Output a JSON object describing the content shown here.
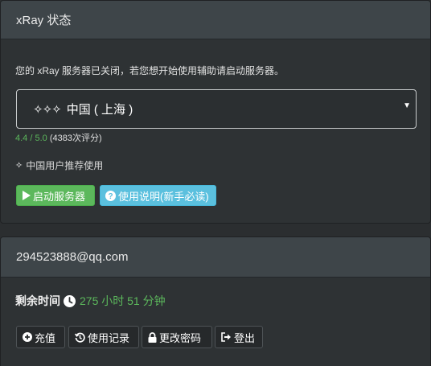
{
  "status_panel": {
    "title": "xRay 状态",
    "description": "您的 xRay 服务器已关闭，若您想开始使用辅助请启动服务器。",
    "server_select": {
      "selected": "中国 ( 上海 )",
      "rating_score": "4.4 / 5.0",
      "rating_count": "(4383次评分)"
    },
    "recommend_text": "中国用户推荐使用",
    "buttons": {
      "start": "启动服务器",
      "help": "使用说明(新手必读)"
    }
  },
  "account_panel": {
    "email": "294523888@qq.com",
    "remaining_label": "剩余时间",
    "remaining_value": "275 小时 51 分钟",
    "buttons": {
      "recharge": "充值",
      "history": "使用记录",
      "change_password": "更改密码",
      "logout": "登出"
    }
  },
  "colors": {
    "success": "#5cb85c",
    "info": "#5bc0de",
    "panel_heading": "#3e4549",
    "background": "#2e3234"
  },
  "icons": {
    "sparkle": "sparkles-icon",
    "play": "play-icon",
    "help": "question-circle-icon",
    "clock": "clock-icon",
    "plus": "plus-circle-icon",
    "history": "history-icon",
    "lock": "lock-icon",
    "logout": "logout-icon",
    "caret": "caret-down-icon"
  }
}
